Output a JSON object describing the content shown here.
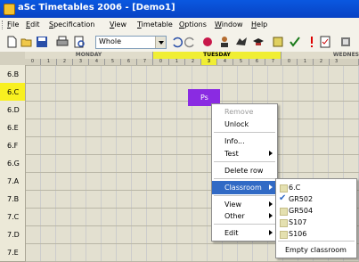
{
  "window": {
    "title": "aSc Timetables 2006  - [Demo1]",
    "brand_color": "#0a58e0"
  },
  "menubar": [
    {
      "label": "File",
      "mnemonic": "F"
    },
    {
      "label": "Edit",
      "mnemonic": "E"
    },
    {
      "label": "Specification",
      "mnemonic": "S"
    },
    {
      "label": "View",
      "mnemonic": "V"
    },
    {
      "label": "Timetable",
      "mnemonic": "T"
    },
    {
      "label": "Options",
      "mnemonic": "O"
    },
    {
      "label": "Window",
      "mnemonic": "W"
    },
    {
      "label": "Help",
      "mnemonic": "H"
    }
  ],
  "toolbar": {
    "view_select": "Whole",
    "icons": [
      "new-icon",
      "open-icon",
      "save-icon",
      "print-icon",
      "print-preview-icon",
      "undo-icon",
      "redo-icon",
      "color-icon",
      "teacher-icon",
      "wolf-icon",
      "hat-icon",
      "classroom-icon",
      "check-icon",
      "warning-icon",
      "report-icon",
      "settings-icon"
    ]
  },
  "grid": {
    "days": [
      {
        "name": "MONDAY",
        "periods": [
          "0",
          "1",
          "2",
          "3",
          "4",
          "5",
          "6",
          "7"
        ]
      },
      {
        "name": "TUESDAY",
        "periods": [
          "0",
          "1",
          "2",
          "3",
          "4",
          "5",
          "6",
          "7"
        ],
        "current_period": "3"
      },
      {
        "name": "WEDNES",
        "periods": [
          "0",
          "1",
          "2",
          "3"
        ]
      }
    ],
    "rows": [
      "6.B",
      "6.C",
      "6.D",
      "6.E",
      "6.F",
      "6.G",
      "7.A",
      "7.B",
      "7.C",
      "7.D",
      "7.E"
    ],
    "selected_row": "6.C",
    "lesson": {
      "label": "Ps",
      "color": "#8a2be2"
    }
  },
  "context_menu": {
    "items": [
      {
        "label": "Remove",
        "disabled": true
      },
      {
        "label": "Unlock"
      },
      {
        "separator": true
      },
      {
        "label": "Info..."
      },
      {
        "label": "Test",
        "submenu": true
      },
      {
        "separator": true
      },
      {
        "label": "Delete row"
      },
      {
        "separator": true
      },
      {
        "label": "Classroom",
        "submenu": true,
        "highlighted": true
      },
      {
        "separator": true
      },
      {
        "label": "View",
        "submenu": true
      },
      {
        "label": "Other",
        "submenu": true
      },
      {
        "separator": true
      },
      {
        "label": "Edit",
        "submenu": true
      }
    ]
  },
  "classroom_submenu": {
    "items": [
      {
        "label": "6.C",
        "checked": false
      },
      {
        "label": "GR502",
        "checked": true
      },
      {
        "label": "GR504",
        "checked": false
      },
      {
        "label": "S107",
        "checked": false
      },
      {
        "label": "S106",
        "checked": false
      }
    ],
    "empty_label": "Empty classroom"
  }
}
